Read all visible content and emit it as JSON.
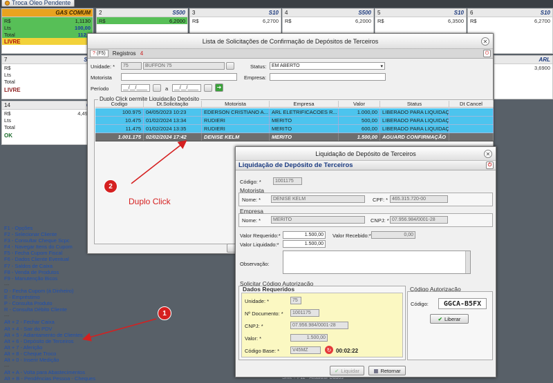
{
  "topbar": {
    "button_label": "Troca Óleo Pendente"
  },
  "tiles_row1": [
    {
      "num": "",
      "name": "GAS COMUM",
      "price": "1,1130",
      "lts": "100,00",
      "total": "112,3",
      "status": "LIVRE",
      "status_count": "2",
      "green": true
    },
    {
      "num": "2",
      "name": "S500",
      "price": "6,2000",
      "lts": "",
      "total": "",
      "status": "",
      "green": true
    },
    {
      "num": "3",
      "name": "S10",
      "price": "6,2700",
      "lts": "",
      "total": "",
      "status": ""
    },
    {
      "num": "4",
      "name": "S500",
      "price": "6,2000",
      "lts": "",
      "total": "",
      "status": ""
    },
    {
      "num": "5",
      "name": "S10",
      "price": "6,3500",
      "lts": "",
      "total": "",
      "status": ""
    },
    {
      "num": "6",
      "name": "S10",
      "price": "6,2700",
      "lts": "",
      "total": "",
      "status": ""
    }
  ],
  "tiles_row2": [
    {
      "num": "7",
      "name": "S5",
      "price": "",
      "status": "LIVRE"
    },
    {
      "num": "",
      "name": "ARL",
      "price": "3,6900",
      "status": ""
    }
  ],
  "tiles_row3": [
    {
      "num": "14",
      "name": "G",
      "price": "4,490",
      "status": "OK"
    }
  ],
  "labels": {
    "rs": "R$",
    "lts": "Lts",
    "total": "Total"
  },
  "shortcuts": [
    "F1 - Opções",
    "F2 - Selecionar Cliente",
    "F3 - Consultar Cheque Scpc",
    "F4 - Navegar Itens do Cupom",
    "F5 - Fecha Cupom Fiscal",
    "F6 - Dados Cliente Eventual",
    "F7 - Saldos de Caixa",
    "F8 - Venda de Produtos",
    "F9 - Manutenção Bicos",
    "---",
    "D - Fecha Cupom (á Dinheiro)",
    "E - Empréstimo",
    "P - Consulta Produto",
    "R - Consulta Débito Cliente",
    "---",
    "Alt + 2 - Fechar Caixa",
    "Alt + 4 - Sair do PDV",
    "Alt + 5 - Adiantamento de Clientes",
    "Alt + 6 - Depósito de Terceiros",
    "Alt + 7 - Aferição",
    "Alt + 8 - Cheque Troco",
    "Alt + 0 - Inserir Medição",
    "---",
    "Alt + A - Volta para Abastecimentos",
    "Alt + B - Pendências Pessoa - Cheques"
  ],
  "bottom_right_text": "Shift + F11 - Atualizar Dados",
  "dialog1": {
    "title": "Lista de Solicitações de Confirmação de  Depósitos de Terceiros",
    "tab_f5": "(F5)",
    "tab_registros": "Registros",
    "registros_count": "4",
    "unidade_label": "Unidade: *",
    "unidade_code": "75",
    "unidade_name": "BUFFON 75",
    "status_label": "Status:",
    "status_value": "EM ABERTO",
    "motorista_label": "Motorista",
    "empresa_label": "Empresa:",
    "periodo_label": "Período",
    "periodo_from": "__/__/____",
    "periodo_a": "a",
    "periodo_to": "__/__/____",
    "grid_caption": "Duplo Click permite Liquidação Depósito",
    "columns": [
      "Codigo",
      "Dt.Solicitação",
      "Motorista",
      "Empresa",
      "Valor",
      "Status",
      "Dt Cancel"
    ],
    "rows": [
      [
        "100.975",
        "04/05/2023 10:23",
        "EDERSON CRISTIANO A...",
        "ARL ELETRIFICACOES R...",
        "1.000,00",
        "LIBERADO PARA LIQUIDAÇÃO",
        ""
      ],
      [
        "10.475",
        "01/02/2024 13:34",
        "RUDIERI",
        "MERITO",
        "500,00",
        "LIBERADO PARA LIQUIDAÇÃO",
        ""
      ],
      [
        "11.475",
        "01/02/2024 13:35",
        "RUDIERI",
        "MERITO",
        "600,00",
        "LIBERADO PARA LIQUIDAÇÃO",
        ""
      ],
      [
        "1.001.175",
        "02/02/2024 17:42",
        "DENISE KELM",
        "MERITO",
        "1.500,00",
        "AGUARD CONFIRMAÇÃO",
        ""
      ]
    ]
  },
  "dialog2": {
    "title": "Liquidação de Depósito de Terceiros",
    "header": "Liquidação de Depósito de Terceiros",
    "codigo_label": "Código: *",
    "codigo_value": "1001175",
    "motorista_section": "Motorista",
    "nome_label": "Nome: *",
    "motorista_nome": "DENISE KELM",
    "cpf_label": "CPF: *",
    "cpf_value": "465.315.720-00",
    "empresa_section": "Empresa",
    "empresa_nome": "MERITO",
    "cnpj_label": "CNPJ: *",
    "cnpj_value": "07.956.984/0001-28",
    "valor_requerido_label": "Valor Requerido:*",
    "valor_requerido": "1.500,00",
    "valor_recebido_label": "Valor Recebido:*",
    "valor_recebido": "0,00",
    "valor_liquidado_label": "Valor Liquidado:*",
    "valor_liquidado": "1.500,00",
    "observacao_label": "Observação:",
    "solicitar_section": "Solicitar Código Autorização",
    "dados_section": "Dados Requeridos",
    "d_unidade_label": "Unidade: *",
    "d_unidade": "75",
    "d_documento_label": "Nº Documento: *",
    "d_documento": "1001175",
    "d_cnpj_label": "CNPJ: *",
    "d_cnpj": "07.956.984/0001-28",
    "d_valor_label": "Valor: *",
    "d_valor": "1.500,00",
    "d_base_label": "Código Base: *",
    "d_base": "V45MZ",
    "timer": "00:02:22",
    "auth_section": "Código Autorização",
    "auth_label": "Código:",
    "auth_value": "GGCA-B5FX",
    "liberar_label": "Liberar",
    "liquidar_label": "Liquidar",
    "retornar_label": "Retornar"
  },
  "annotations": {
    "circle1": "1",
    "circle2": "2",
    "duplo_click": "Duplo Click",
    "accent": "#d52020"
  }
}
